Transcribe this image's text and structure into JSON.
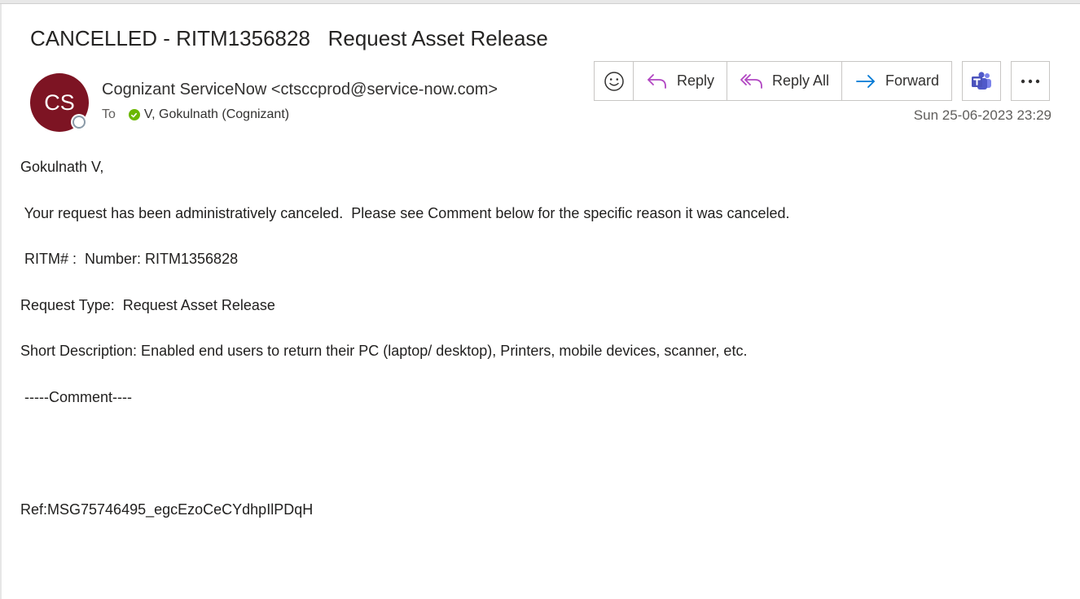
{
  "email": {
    "subject": "CANCELLED - RITM1356828   Request Asset Release",
    "avatar_initials": "CS",
    "avatar_color": "#7d1423",
    "sender": "Cognizant ServiceNow <ctsccprod@service-now.com>",
    "to_label": "To",
    "recipient": "V, Gokulnath (Cognizant)",
    "date": "Sun 25-06-2023 23:29"
  },
  "toolbar": {
    "emoji_icon": "smiley-icon",
    "reply_label": "Reply",
    "reply_all_label": "Reply All",
    "forward_label": "Forward",
    "teams_icon": "teams-icon",
    "more_icon": "more-icon",
    "reply_color": "#b146c2",
    "forward_color": "#0078d4"
  },
  "body": {
    "greeting": "Gokulnath V,",
    "line1": " Your request has been administratively canceled.  Please see Comment below for the specific reason it was canceled.",
    "line2": " RITM# :  Number: RITM1356828",
    "line3": "Request Type:  Request Asset Release",
    "line4": "Short Description: Enabled end users to return their PC (laptop/ desktop), Printers, mobile devices, scanner, etc.",
    "comment_header": " -----Comment----",
    "ref": "Ref:MSG75746495_egcEzoCeCYdhpIlPDqH"
  }
}
